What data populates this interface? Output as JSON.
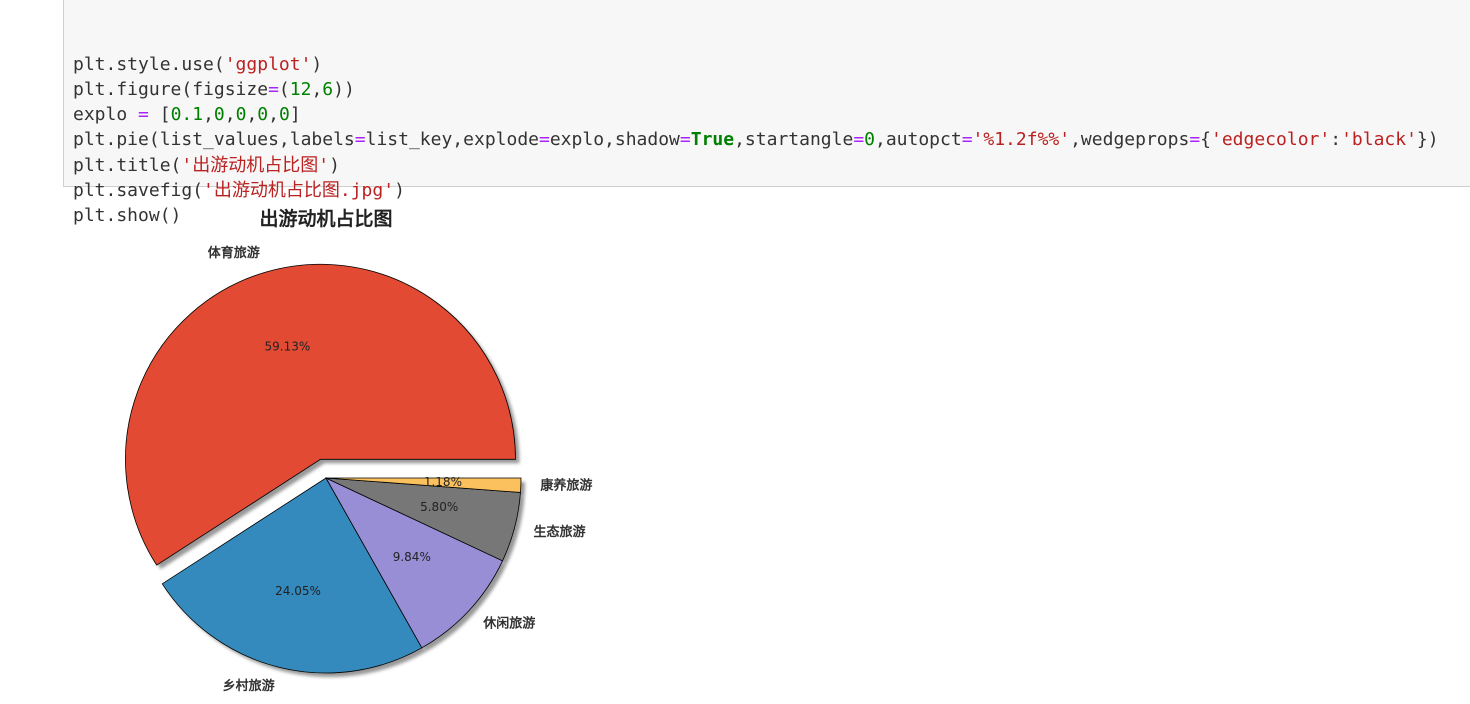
{
  "code_cell": {
    "lines": [
      [
        {
          "t": "plt.style.use(",
          "c": ""
        },
        {
          "t": "'ggplot'",
          "c": "str"
        },
        {
          "t": ")",
          "c": ""
        }
      ],
      [
        {
          "t": "plt.figure(figsize",
          "c": ""
        },
        {
          "t": "=",
          "c": "op"
        },
        {
          "t": "(",
          "c": ""
        },
        {
          "t": "12",
          "c": "num"
        },
        {
          "t": ",",
          "c": ""
        },
        {
          "t": "6",
          "c": "num"
        },
        {
          "t": "))",
          "c": ""
        }
      ],
      [
        {
          "t": "explo ",
          "c": ""
        },
        {
          "t": "=",
          "c": "op"
        },
        {
          "t": " [",
          "c": ""
        },
        {
          "t": "0.1",
          "c": "num"
        },
        {
          "t": ",",
          "c": ""
        },
        {
          "t": "0",
          "c": "num"
        },
        {
          "t": ",",
          "c": ""
        },
        {
          "t": "0",
          "c": "num"
        },
        {
          "t": ",",
          "c": ""
        },
        {
          "t": "0",
          "c": "num"
        },
        {
          "t": ",",
          "c": ""
        },
        {
          "t": "0",
          "c": "num"
        },
        {
          "t": "]",
          "c": ""
        }
      ],
      [
        {
          "t": "plt.pie(list_values,labels",
          "c": ""
        },
        {
          "t": "=",
          "c": "op"
        },
        {
          "t": "list_key,explode",
          "c": ""
        },
        {
          "t": "=",
          "c": "op"
        },
        {
          "t": "explo,shadow",
          "c": ""
        },
        {
          "t": "=",
          "c": "op"
        },
        {
          "t": "True",
          "c": "kw"
        },
        {
          "t": ",startangle",
          "c": ""
        },
        {
          "t": "=",
          "c": "op"
        },
        {
          "t": "0",
          "c": "num"
        },
        {
          "t": ",autopct",
          "c": ""
        },
        {
          "t": "=",
          "c": "op"
        },
        {
          "t": "'%1.2f%%'",
          "c": "str"
        },
        {
          "t": ",wedgeprops",
          "c": ""
        },
        {
          "t": "=",
          "c": "op"
        },
        {
          "t": "{",
          "c": ""
        },
        {
          "t": "'edgecolor'",
          "c": "str"
        },
        {
          "t": ":",
          "c": ""
        },
        {
          "t": "'black'",
          "c": "str"
        },
        {
          "t": "})",
          "c": ""
        }
      ],
      [
        {
          "t": "plt.title(",
          "c": ""
        },
        {
          "t": "'出游动机占比图'",
          "c": "str"
        },
        {
          "t": ")",
          "c": ""
        }
      ],
      [
        {
          "t": "plt.savefig(",
          "c": ""
        },
        {
          "t": "'出游动机占比图.jpg'",
          "c": "str"
        },
        {
          "t": ")",
          "c": ""
        }
      ],
      [
        {
          "t": "plt.show()",
          "c": ""
        }
      ]
    ]
  },
  "chart_data": {
    "type": "pie",
    "title": "出游动机占比图",
    "labels": [
      "体育旅游",
      "乡村旅游",
      "休闲旅游",
      "生态旅游",
      "康养旅游"
    ],
    "values": [
      59.13,
      24.05,
      9.84,
      5.8,
      1.18
    ],
    "pct_labels": [
      "59.13%",
      "24.05%",
      "9.84%",
      "5.80%",
      "1.18%"
    ],
    "colors": [
      "#e24a33",
      "#348abd",
      "#988ed5",
      "#777777",
      "#fbc15e"
    ],
    "explode": [
      0.1,
      0,
      0,
      0,
      0
    ],
    "startangle": 0,
    "shadow": true,
    "edgecolor": "#000000"
  }
}
